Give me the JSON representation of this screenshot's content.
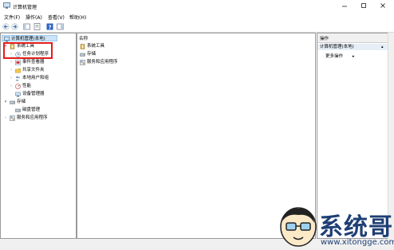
{
  "window": {
    "title": "计算机管理"
  },
  "menu": [
    "文件(F)",
    "操作(A)",
    "查看(V)",
    "帮助(H)"
  ],
  "tree": {
    "root": "计算机管理(本地)",
    "system_tools": "系统工具",
    "task_scheduler": "任务计划程序",
    "event_viewer": "事件查看器",
    "shared_folders": "共享文件夹",
    "local_users": "本地用户和组",
    "performance": "性能",
    "device_manager": "设备管理器",
    "storage": "存储",
    "disk_management": "磁盘管理",
    "services_apps": "服务和应用程序"
  },
  "center": {
    "column_header": "名称",
    "items": [
      "系统工具",
      "存储",
      "服务和应用程序"
    ]
  },
  "actions": {
    "header": "操作",
    "selected": "计算机管理(本地)",
    "more": "更多操作"
  },
  "watermark": {
    "brand": "系统哥",
    "url": "www.xitongge.com"
  },
  "colors": {
    "highlight": "#cce4f7",
    "red_box": "#e41c1c"
  }
}
